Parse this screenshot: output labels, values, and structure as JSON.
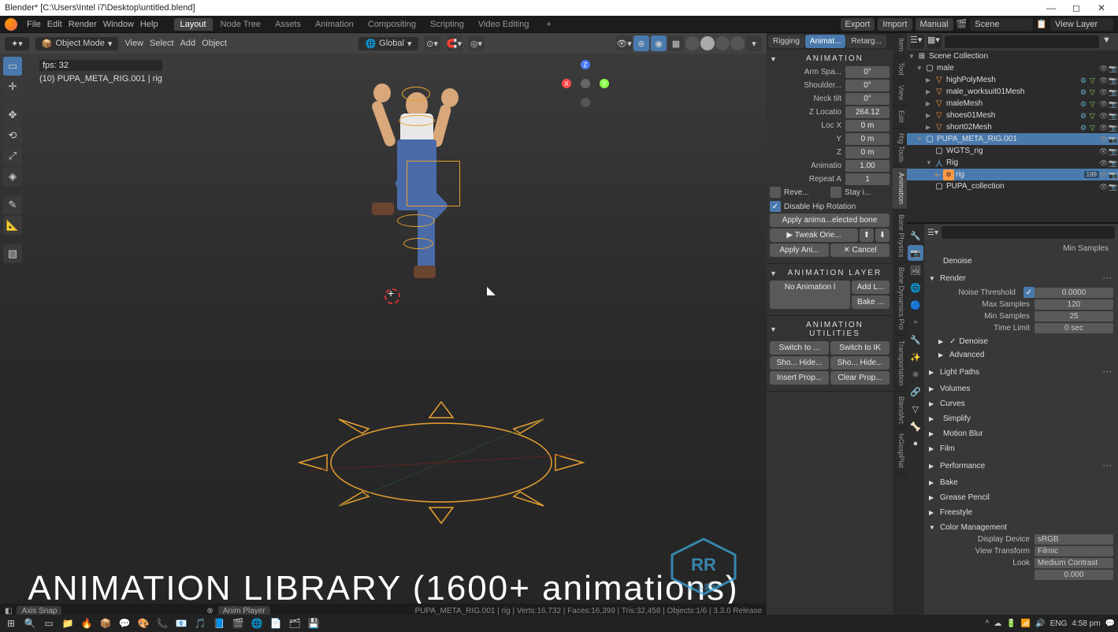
{
  "window_title": "Blender* [C:\\Users\\Intel i7\\Desktop\\untitled.blend]",
  "top_menu": [
    "File",
    "Edit",
    "Render",
    "Window",
    "Help"
  ],
  "workspace_tabs": [
    "Layout",
    "Node Tree",
    "Assets",
    "Animation",
    "Compositing",
    "Scripting",
    "Video Editing"
  ],
  "top_right": {
    "export": "Export",
    "import": "Import",
    "manual": "Manual",
    "scene": "Scene",
    "layer": "View Layer"
  },
  "viewport": {
    "mode": "Object Mode",
    "menus": [
      "View",
      "Select",
      "Add",
      "Object"
    ],
    "orient": "Global",
    "fps": "fps: 32",
    "obj": "(10) PUPA_META_RIG.001 | rig"
  },
  "overlay": "ANIMATION LIBRARY (1600+ animations)",
  "status": {
    "left": "Axis Snap",
    "center": "Anim Player",
    "stats": "PUPA_META_RIG.001 | rig | Verts:16,732 | Faces:16,399 | Tris:32,458 | Objects:1/6 | 3.3.0 Release"
  },
  "npanel": {
    "tabs": [
      "Rigging",
      "Animat...",
      "Retarg..."
    ],
    "anim_header": "ANIMATION",
    "arm_spa": {
      "lbl": "Arm Spa...",
      "val": "0°"
    },
    "shoulder": {
      "lbl": "Shoulder...",
      "val": "0°"
    },
    "neck": {
      "lbl": "Neck tilt",
      "val": "0°"
    },
    "zloc": {
      "lbl": "Z Locatio",
      "val": "264.12"
    },
    "locx": {
      "lbl": "Loc X",
      "val": "0 m"
    },
    "locy": {
      "lbl": "Y",
      "val": "0 m"
    },
    "locz": {
      "lbl": "Z",
      "val": "0 m"
    },
    "animatio": {
      "lbl": "Animatio",
      "val": "1.00"
    },
    "repeata": {
      "lbl": "Repeat A",
      "val": "1"
    },
    "reve": "Reve...",
    "stay": "Stay i...",
    "disable_hip": "Disable Hip Rotation",
    "apply_long": "Apply anima...elected bone",
    "tweak": "Tweak Orie...",
    "apply": "Apply Ani...",
    "cancel": "Cancel",
    "layer_header": "ANIMATION LAYER",
    "noanim": "No Animation l",
    "addl": "Add L...",
    "bake": "Bake ...",
    "util_header": "ANIMATION UTILITIES",
    "sw1": "Switch to ...",
    "sw2": "Switch to IK",
    "sho1": "Sho... Hide...",
    "sho2": "Sho... Hide...",
    "ins": "Insert Prop...",
    "clr": "Clear Prop..."
  },
  "vtabs": [
    "Item",
    "Tool",
    "View",
    "Edit",
    "Rig Tools",
    "Animation",
    "Bone Physics",
    "Bone Dynamics Pro",
    "Transportation",
    "BlendArt",
    "IvGospPlat"
  ],
  "outliner": {
    "scene": "Scene Collection",
    "items": [
      {
        "d": 1,
        "ico": "coll",
        "nm": "male",
        "tri": "▼"
      },
      {
        "d": 2,
        "ico": "mesh",
        "nm": "highPolyMesh",
        "tri": "▶"
      },
      {
        "d": 2,
        "ico": "mesh",
        "nm": "male_worksuit01Mesh",
        "tri": "▶"
      },
      {
        "d": 2,
        "ico": "mesh",
        "nm": "maleMesh",
        "tri": "▶"
      },
      {
        "d": 2,
        "ico": "mesh",
        "nm": "shoes01Mesh",
        "tri": "▶"
      },
      {
        "d": 2,
        "ico": "mesh",
        "nm": "short02Mesh",
        "tri": "▶"
      },
      {
        "d": 1,
        "ico": "coll",
        "nm": "PUPA_META_RIG.001",
        "tri": "▼",
        "sel": true
      },
      {
        "d": 2,
        "ico": "coll",
        "nm": "WGTS_rig",
        "tri": ""
      },
      {
        "d": 2,
        "ico": "arm",
        "nm": "Rig",
        "tri": "▼"
      },
      {
        "d": 3,
        "ico": "rig",
        "nm": "rig",
        "tri": "▶",
        "sel": true,
        "extra": "199"
      },
      {
        "d": 2,
        "ico": "coll",
        "nm": "PUPA_collection",
        "tri": ""
      }
    ]
  },
  "props": {
    "denoise": "Denoise",
    "render": "Render",
    "noise_thr": {
      "lbl": "Noise Threshold",
      "val": "0.0000"
    },
    "max_samp": {
      "lbl": "Max Samples",
      "val": "120"
    },
    "min_samp": {
      "lbl": "Min Samples",
      "val": "25"
    },
    "time_limit": {
      "lbl": "Time Limit",
      "val": "0 sec"
    },
    "denoise2": "Denoise",
    "advanced": "Advanced",
    "lightpaths": "Light Paths",
    "volumes": "Volumes",
    "curves": "Curves",
    "simplify": "Simplify",
    "motionblur": "Motion Blur",
    "film": "Film",
    "performance": "Performance",
    "bake": "Bake",
    "grease": "Grease Pencil",
    "freestyle": "Freestyle",
    "colormgmt": "Color Management",
    "disp_dev": {
      "lbl": "Display Device",
      "val": "sRGB"
    },
    "view_tr": {
      "lbl": "View Transform",
      "val": "Filmic"
    },
    "look": {
      "lbl": "Look",
      "val": "Medium Contrast"
    },
    "val000": "0.000"
  },
  "taskbar": {
    "lang": "ENG",
    "time": "4:58 pm",
    "date": "4:58 pm"
  }
}
